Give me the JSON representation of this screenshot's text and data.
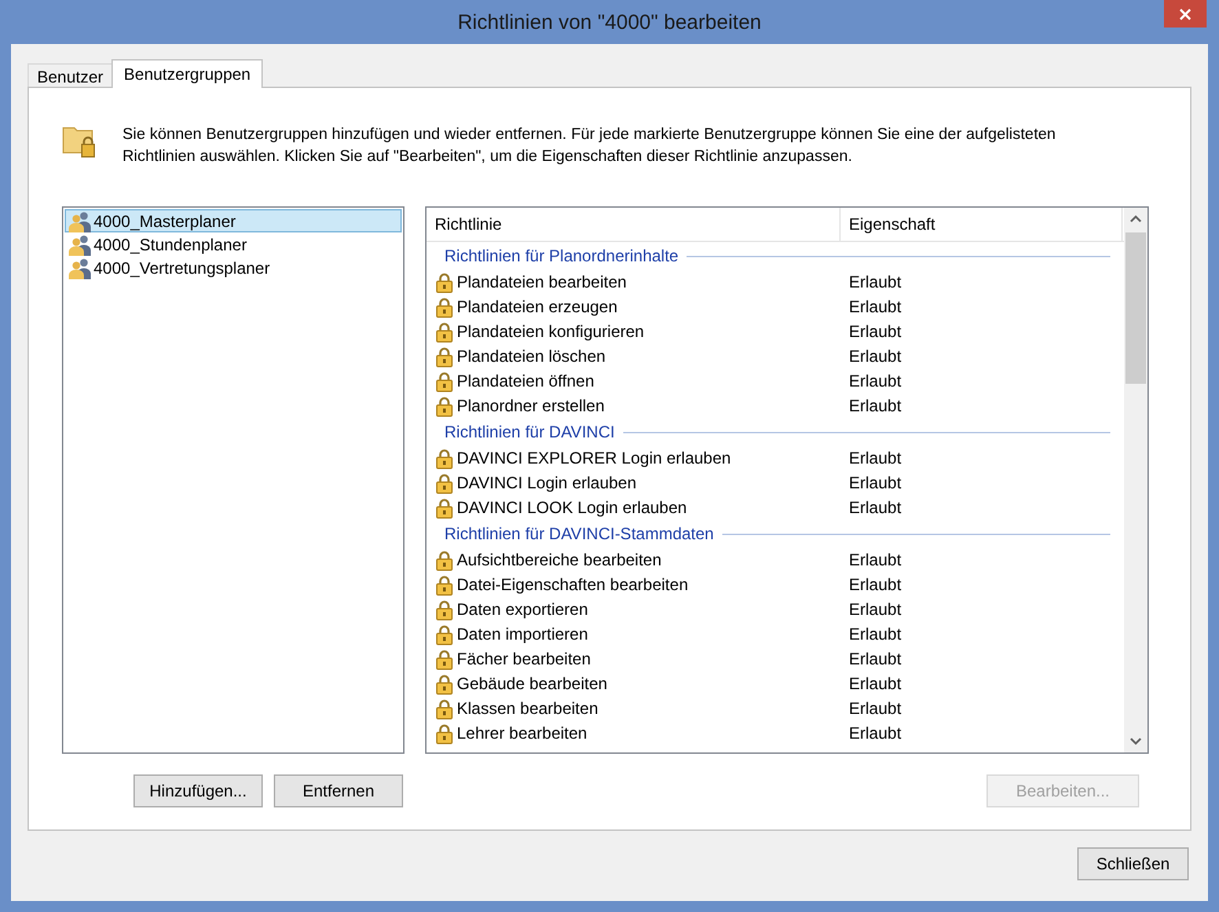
{
  "window": {
    "title": "Richtlinien von \"4000\" bearbeiten"
  },
  "tabs": [
    {
      "label": "Benutzer",
      "selected": false
    },
    {
      "label": "Benutzergruppen",
      "selected": true
    }
  ],
  "description": "Sie können Benutzergruppen hinzufügen und wieder entfernen. Für jede markierte Benutzergruppe können Sie eine der aufgelisteten Richtlinien auswählen. Klicken Sie auf \"Bearbeiten\", um die Eigenschaften dieser Richtlinie anzupassen.",
  "groups": [
    {
      "name": "4000_Masterplaner",
      "selected": true
    },
    {
      "name": "4000_Stundenplaner",
      "selected": false
    },
    {
      "name": "4000_Vertretungsplaner",
      "selected": false
    }
  ],
  "policy_table": {
    "columns": [
      "Richtlinie",
      "Eigenschaft"
    ],
    "sections": [
      {
        "title": "Richtlinien für Planordnerinhalte",
        "rows": [
          {
            "name": "Plandateien bearbeiten",
            "value": "Erlaubt"
          },
          {
            "name": "Plandateien erzeugen",
            "value": "Erlaubt"
          },
          {
            "name": "Plandateien konfigurieren",
            "value": "Erlaubt"
          },
          {
            "name": "Plandateien löschen",
            "value": "Erlaubt"
          },
          {
            "name": "Plandateien öffnen",
            "value": "Erlaubt"
          },
          {
            "name": "Planordner erstellen",
            "value": "Erlaubt"
          }
        ]
      },
      {
        "title": "Richtlinien für DAVINCI",
        "rows": [
          {
            "name": "DAVINCI EXPLORER Login erlauben",
            "value": "Erlaubt"
          },
          {
            "name": "DAVINCI Login erlauben",
            "value": "Erlaubt"
          },
          {
            "name": "DAVINCI LOOK Login erlauben",
            "value": "Erlaubt"
          }
        ]
      },
      {
        "title": "Richtlinien für DAVINCI-Stammdaten",
        "rows": [
          {
            "name": "Aufsichtbereiche bearbeiten",
            "value": "Erlaubt"
          },
          {
            "name": "Datei-Eigenschaften bearbeiten",
            "value": "Erlaubt"
          },
          {
            "name": "Daten exportieren",
            "value": "Erlaubt"
          },
          {
            "name": "Daten importieren",
            "value": "Erlaubt"
          },
          {
            "name": "Fächer bearbeiten",
            "value": "Erlaubt"
          },
          {
            "name": "Gebäude bearbeiten",
            "value": "Erlaubt"
          },
          {
            "name": "Klassen bearbeiten",
            "value": "Erlaubt"
          },
          {
            "name": "Lehrer bearbeiten",
            "value": "Erlaubt"
          }
        ]
      }
    ]
  },
  "buttons": [
    {
      "label": "Hinzufügen...",
      "disabled": false
    },
    {
      "label": "Entfernen",
      "disabled": false
    },
    {
      "label": "Bearbeiten...",
      "disabled": true
    }
  ],
  "close_button": {
    "label": "Schließen"
  }
}
